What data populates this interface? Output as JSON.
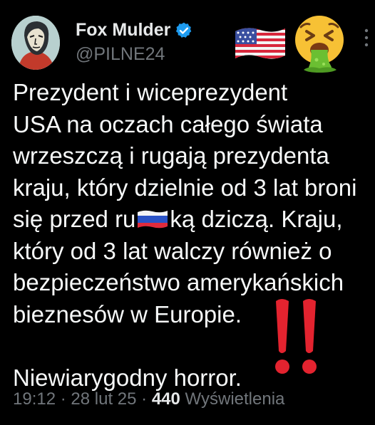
{
  "author": {
    "display_name": "Fox Mulder",
    "handle": "@PILNE24",
    "verified": true,
    "avatar_icon": "face-portrait-avatar"
  },
  "header_emojis": [
    "us-flag-icon",
    "vomiting-face-icon"
  ],
  "tweet": {
    "line1": "Prezydent i wiceprezydent",
    "line2": "USA na oczach całego świata",
    "line3": "wrzeszczą i rugają prezydenta",
    "line4": "kraju, który dzielnie od 3 lat broni",
    "line5_a": "się przed ru",
    "line5_flag": "russia-flag-icon",
    "line5_b": "ką dziczą. Kraju,",
    "line6": "który od 3 lat walczy również o",
    "line7": "bezpieczeństwo amerykańskich",
    "line8": "bieznesów w Europie.",
    "line9": "",
    "line10": "Niewiarygodny horror.",
    "trailing_emoji": "double-exclamation-icon"
  },
  "meta": {
    "time": "19:12",
    "date": "28 lut 25",
    "views_count": "440",
    "views_label": "Wyświetlenia",
    "separator": "·"
  },
  "colors": {
    "background": "#000000",
    "text": "#e7e9ea",
    "secondary": "#71767b",
    "verified_blue": "#1d9bf0"
  }
}
